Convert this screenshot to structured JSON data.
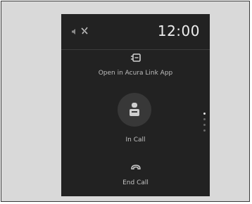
{
  "status_bar": {
    "time": "12:00",
    "icons": [
      "volume-icon",
      "no-signal-icon"
    ]
  },
  "actions": {
    "open_app_label": "Open in Acura Link App",
    "open_app_icon": "phone-link-icon",
    "in_call_label": "In Call",
    "in_call_icon": "person-icon",
    "end_call_label": "End Call",
    "end_call_icon": "hang-up-icon"
  },
  "scroll": {
    "pages": 4,
    "current_page": 1
  },
  "colors": {
    "screen_background": "#222222",
    "frame_background": "#d9d9d9",
    "text": "#c4c4c4",
    "circle": "#383838"
  }
}
